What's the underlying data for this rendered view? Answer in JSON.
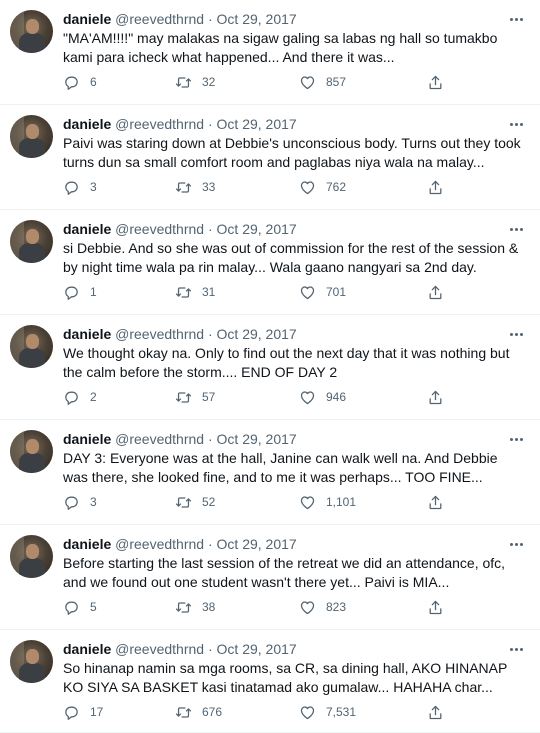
{
  "tweets": [
    {
      "name": "daniele",
      "handle": "@reevedthrnd",
      "dot": "·",
      "date": "Oct 29, 2017",
      "text": "\"MA'AM!!!!\" may malakas na sigaw galing sa labas ng hall so tumakbo kami para icheck what happened... And there it was...",
      "replies": "6",
      "retweets": "32",
      "likes": "857"
    },
    {
      "name": "daniele",
      "handle": "@reevedthrnd",
      "dot": "·",
      "date": "Oct 29, 2017",
      "text": "Paivi was staring down at Debbie's unconscious body. Turns out they took turns dun sa small comfort room and paglabas niya wala na malay...",
      "replies": "3",
      "retweets": "33",
      "likes": "762"
    },
    {
      "name": "daniele",
      "handle": "@reevedthrnd",
      "dot": "·",
      "date": "Oct 29, 2017",
      "text": "si Debbie. And so she was out of commission for the rest of the session & by night time wala pa rin malay... Wala gaano nangyari sa 2nd day.",
      "replies": "1",
      "retweets": "31",
      "likes": "701"
    },
    {
      "name": "daniele",
      "handle": "@reevedthrnd",
      "dot": "·",
      "date": "Oct 29, 2017",
      "text": "We thought okay na. Only to find out the next day that it was nothing but the calm before the storm.... END OF DAY 2",
      "replies": "2",
      "retweets": "57",
      "likes": "946"
    },
    {
      "name": "daniele",
      "handle": "@reevedthrnd",
      "dot": "·",
      "date": "Oct 29, 2017",
      "text": "DAY 3: Everyone was at the hall, Janine can walk well na. And Debbie was there, she looked fine, and to me it was perhaps... TOO FINE...",
      "replies": "3",
      "retweets": "52",
      "likes": "1,101"
    },
    {
      "name": "daniele",
      "handle": "@reevedthrnd",
      "dot": "·",
      "date": "Oct 29, 2017",
      "text": "Before starting the last session of the retreat we did an attendance, ofc, and we found out one student wasn't there yet... Paivi is MIA...",
      "replies": "5",
      "retweets": "38",
      "likes": "823"
    },
    {
      "name": "daniele",
      "handle": "@reevedthrnd",
      "dot": "·",
      "date": "Oct 29, 2017",
      "text": "So hinanap namin sa mga rooms, sa CR, sa dining hall, AKO HINANAP KO SIYA SA BASKET kasi tinatamad ako gumalaw... HAHAHA char...",
      "replies": "17",
      "retweets": "676",
      "likes": "7,531"
    }
  ],
  "icons": {
    "reply": "reply-icon",
    "retweet": "retweet-icon",
    "like": "heart-icon",
    "share": "share-icon",
    "more": "more-icon"
  },
  "colors": {
    "text": "#0f1419",
    "secondary": "#536471",
    "divider": "#eff3f4"
  }
}
